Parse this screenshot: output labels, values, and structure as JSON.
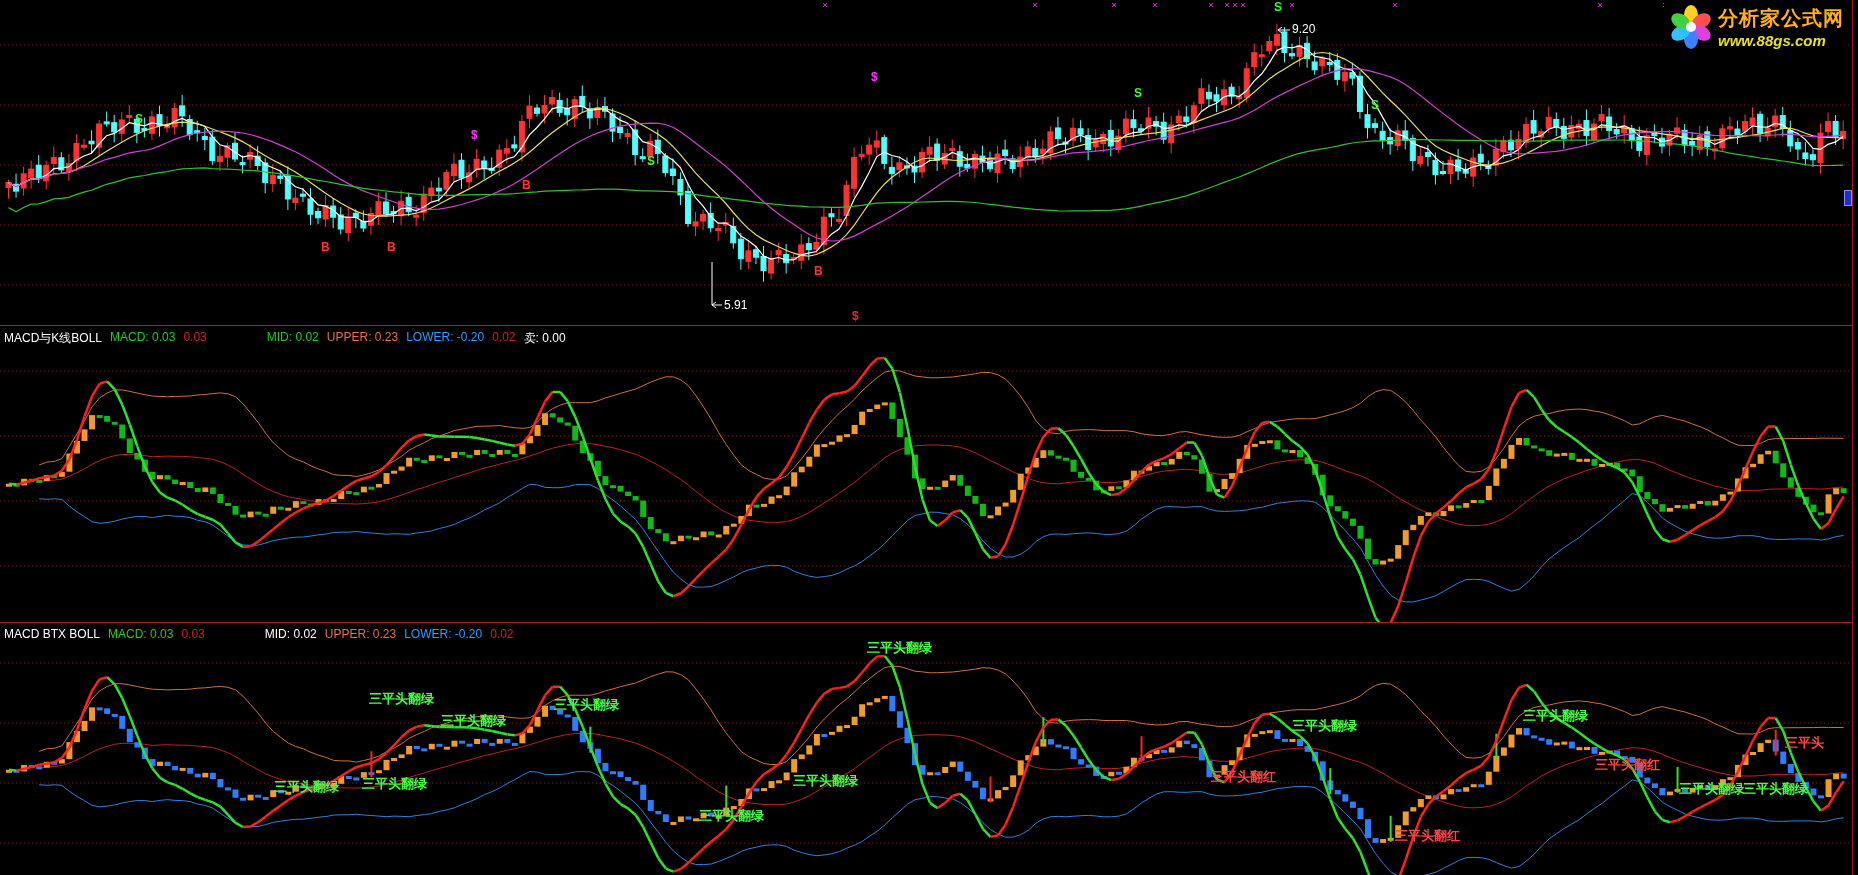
{
  "logo": {
    "title": "分析家公式网",
    "url": "www.88gs.com"
  },
  "price_panel": {
    "high_label": "9.20",
    "low_label": "5.91",
    "signals": [
      {
        "text": "S",
        "color": "#33ff33"
      },
      {
        "text": "B",
        "color": "#ff3333"
      },
      {
        "text": "B",
        "color": "#ff3333"
      },
      {
        "text": "$",
        "color": "#ff33ff"
      },
      {
        "text": "B",
        "color": "#ff3333"
      },
      {
        "text": "S",
        "color": "#33ff33"
      },
      {
        "text": "B",
        "color": "#ff3333"
      },
      {
        "text": "$",
        "color": "#ff2020"
      },
      {
        "text": "$",
        "color": "#ff33ff"
      },
      {
        "text": "S",
        "color": "#33ff33"
      },
      {
        "text": "S",
        "color": "#33ff33"
      },
      {
        "text": "S",
        "color": "#33ff33"
      }
    ]
  },
  "macd_kline_panel": {
    "title": "MACD与K线BOLL",
    "values": [
      {
        "text": "MACD: 0.03",
        "color": "#22cc22"
      },
      {
        "text": "0.03",
        "color": "#cc2020"
      }
    ],
    "bands": [
      {
        "text": "MID: 0.02",
        "color": "#22cc22"
      },
      {
        "text": "UPPER: 0.23",
        "color": "#e07050"
      },
      {
        "text": "LOWER: -0.20",
        "color": "#3399ff"
      },
      {
        "text": "0.02",
        "color": "#cc2020"
      },
      {
        "text": "卖: 0.00",
        "color": "#ffffff"
      }
    ]
  },
  "macd_btx_panel": {
    "title": "MACD BTX BOLL",
    "values": [
      {
        "text": "MACD: 0.03",
        "color": "#22cc22"
      },
      {
        "text": "0.03",
        "color": "#cc2020"
      }
    ],
    "bands": [
      {
        "text": "MID: 0.02",
        "color": "#ffffff"
      },
      {
        "text": "UPPER: 0.23",
        "color": "#e07050"
      },
      {
        "text": "LOWER: -0.20",
        "color": "#3399ff"
      },
      {
        "text": "0.02",
        "color": "#cc2020"
      }
    ],
    "annotations": [
      {
        "text": "三平头翻绿",
        "color": "#44ff44"
      },
      {
        "text": "三平头翻绿",
        "color": "#44ff44"
      },
      {
        "text": "三平头翻绿",
        "color": "#44ff44"
      },
      {
        "text": "三平头翻绿",
        "color": "#44ff44"
      },
      {
        "text": "三平头翻绿",
        "color": "#44ff44"
      },
      {
        "text": "三平头翻绿",
        "color": "#44ff44"
      },
      {
        "text": "三平头翻绿",
        "color": "#44ff44"
      },
      {
        "text": "三平头翻绿",
        "color": "#44ff44"
      },
      {
        "text": "三平头翻红",
        "color": "#ff4444"
      },
      {
        "text": "三平头翻红",
        "color": "#ff4444"
      },
      {
        "text": "三平头翻绿",
        "color": "#44ff44"
      },
      {
        "text": "三平头翻红",
        "color": "#ff4444"
      },
      {
        "text": "三平头翻绿",
        "color": "#44ff44"
      },
      {
        "text": "三平头翻绿",
        "color": "#44ff44"
      },
      {
        "text": "三平头翻绿",
        "color": "#44ff44"
      },
      {
        "text": "三平头",
        "color": "#ff4444"
      }
    ]
  }
}
